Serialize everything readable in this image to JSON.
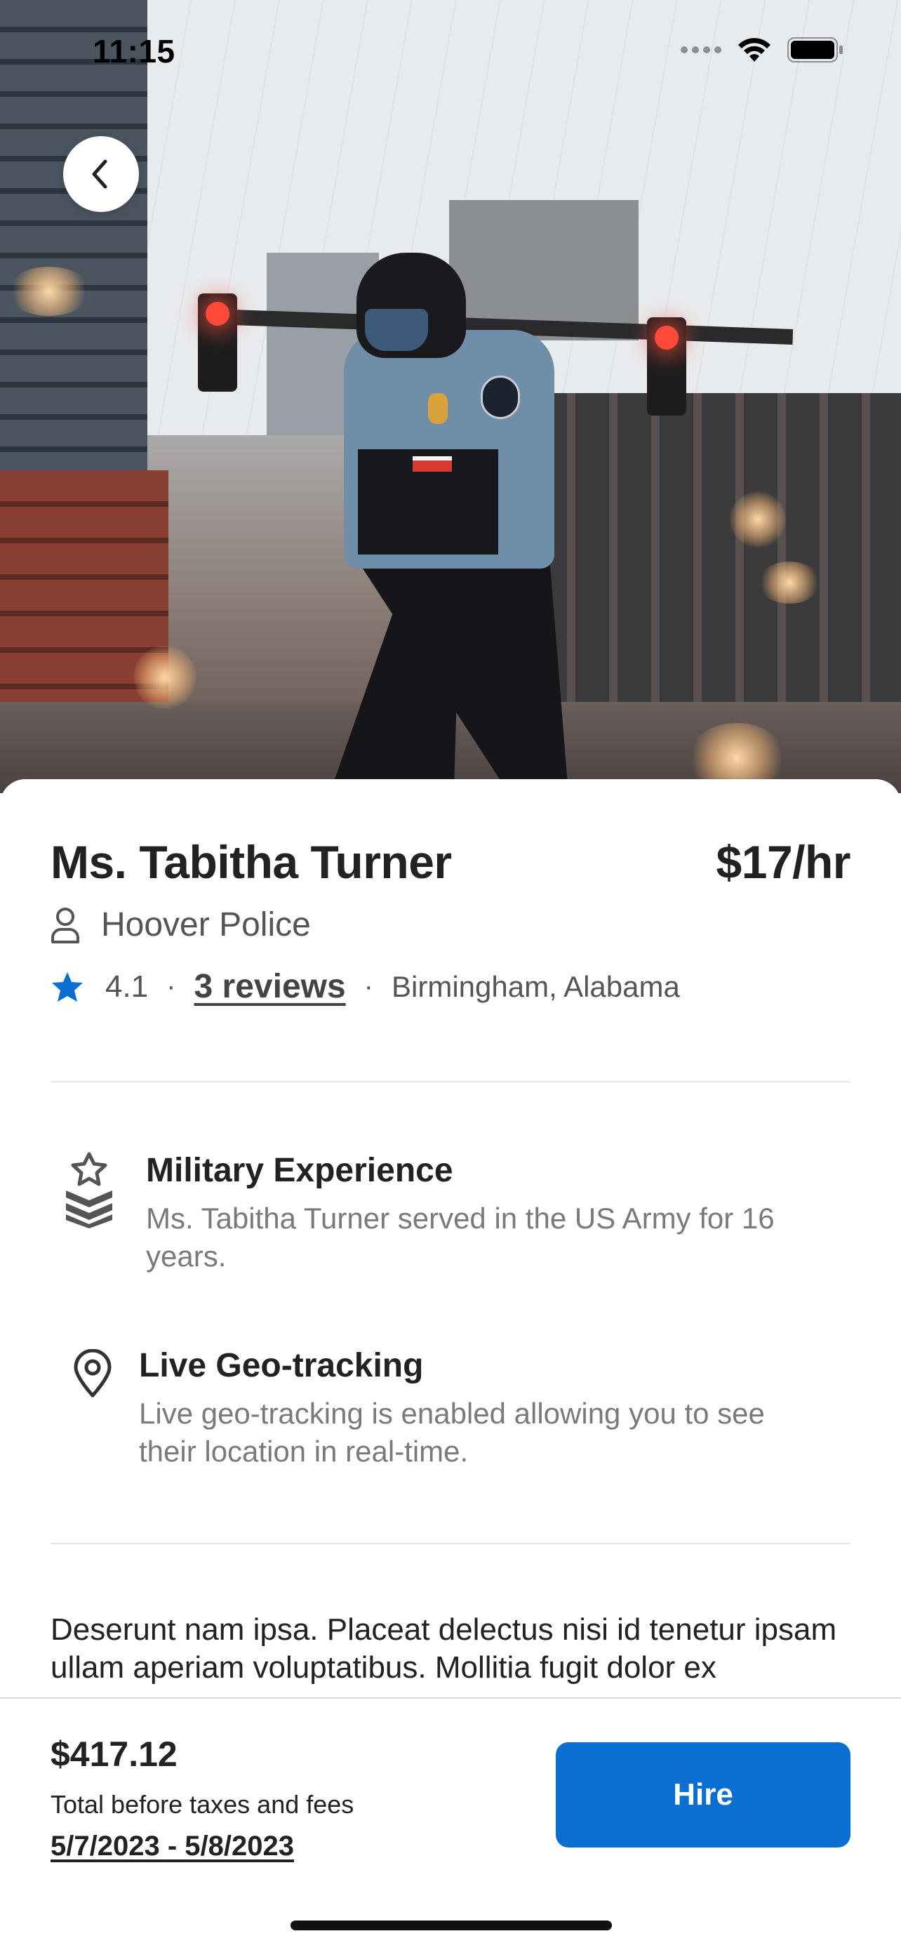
{
  "status_bar": {
    "time": "11:15"
  },
  "profile": {
    "name": "Ms. Tabitha Turner",
    "rate": "$17/hr",
    "agency": "Hoover Police",
    "rating": "4.1",
    "reviews_link": "3 reviews",
    "separator": "·",
    "location": "Birmingham, Alabama"
  },
  "features": [
    {
      "icon": "military-rank-icon",
      "title": "Military Experience",
      "description": "Ms. Tabitha Turner served in the US Army for 16 years."
    },
    {
      "icon": "location-pin-icon",
      "title": "Live Geo-tracking",
      "description": "Live geo-tracking is enabled allowing you to see their location in real-time."
    }
  ],
  "description": "Deserunt nam ipsa. Placeat delectus nisi id tenetur ipsam ullam aperiam voluptatibus. Mollitia fugit dolor ex",
  "booking": {
    "total": "$417.12",
    "total_label": "Total before taxes and fees",
    "dates": "5/7/2023 - 5/8/2023",
    "hire_label": "Hire"
  },
  "colors": {
    "accent": "#0a6fd1",
    "star": "#0a6fd1",
    "text_primary": "#222222",
    "text_secondary": "#7a7a7a"
  }
}
